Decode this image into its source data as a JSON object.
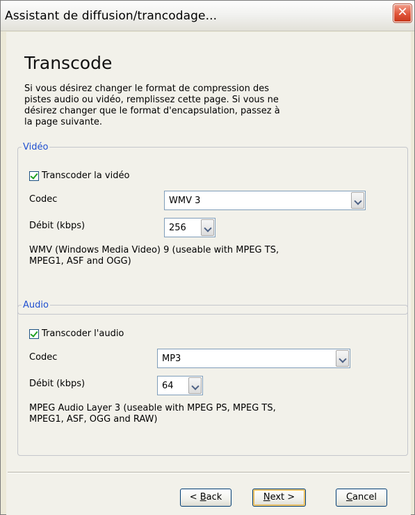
{
  "window": {
    "title": "Assistant de diffusion/trancodage...",
    "close_glyph": "✕"
  },
  "page": {
    "heading": "Transcode",
    "intro": "Si vous désirez changer le format de compression des pistes audio ou vidéo, remplissez cette page. Si vous ne désirez changer que le format d'encapsulation, passez à la page suivante."
  },
  "video": {
    "legend": "Vidéo",
    "checkbox_label": "Transcoder la vidéo",
    "checked": true,
    "codec_label": "Codec",
    "codec_value": "WMV 3",
    "bitrate_label": "Débit (kbps)",
    "bitrate_value": "256",
    "description_line1": "WMV (Windows Media Video) 9 (useable with MPEG TS,",
    "description_line2": "MPEG1, ASF and OGG)"
  },
  "audio": {
    "legend": "Audio",
    "checkbox_label": "Transcoder l'audio",
    "checked": true,
    "codec_label": "Codec",
    "codec_value": "MP3",
    "bitrate_label": "Débit (kbps)",
    "bitrate_value": "64",
    "description_line1": "MPEG Audio Layer 3 (useable with MPEG PS, MPEG TS,",
    "description_line2": "MPEG1, ASF, OGG and RAW)"
  },
  "buttons": {
    "back_prefix": "< ",
    "back_mnemonic": "B",
    "back_rest": "ack",
    "next_mnemonic": "N",
    "next_rest": "ext >",
    "cancel_mnemonic": "C",
    "cancel_rest": "ancel"
  },
  "icons": {
    "close": "close-icon",
    "dropdown": "chevron-down-icon",
    "check": "checkmark-icon"
  }
}
